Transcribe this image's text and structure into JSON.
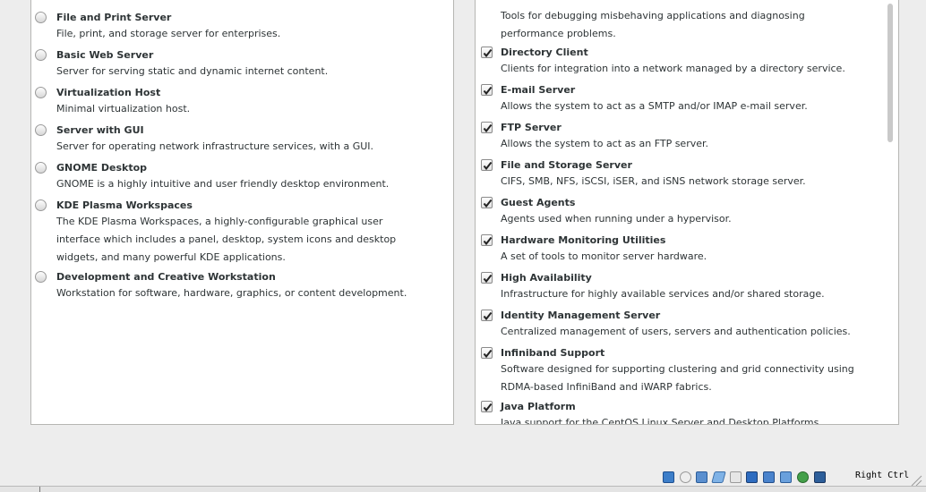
{
  "environment_groups": [
    {
      "title": "",
      "desc": "File, print, and storage server for enterprises.",
      "title_label": "File and Print Server"
    },
    {
      "title_label": "Basic Web Server",
      "desc": "Server for serving static and dynamic internet content."
    },
    {
      "title_label": "Virtualization Host",
      "desc": "Minimal virtualization host."
    },
    {
      "title_label": "Server with GUI",
      "desc": "Server for operating network infrastructure services, with a GUI."
    },
    {
      "title_label": "GNOME Desktop",
      "desc": "GNOME is a highly intuitive and user friendly desktop environment."
    },
    {
      "title_label": "KDE Plasma Workspaces",
      "desc_lines": [
        "The KDE Plasma Workspaces, a highly-configurable graphical user",
        "interface which includes a panel, desktop, system icons and desktop",
        "widgets, and many powerful KDE applications."
      ]
    },
    {
      "title_label": "Development and Creative Workstation",
      "desc": "Workstation for software, hardware, graphics, or content development."
    }
  ],
  "addons": [
    {
      "desc_lines": [
        "Tools for debugging misbehaving applications and diagnosing",
        "performance problems."
      ]
    },
    {
      "title_label": "Directory Client",
      "desc": "Clients for integration into a network managed by a directory service.",
      "checked": true
    },
    {
      "title_label": "E-mail Server",
      "desc": "Allows the system to act as a SMTP and/or IMAP e-mail server.",
      "checked": true
    },
    {
      "title_label": "FTP Server",
      "desc": "Allows the system to act as an FTP server.",
      "checked": true
    },
    {
      "title_label": "File and Storage Server",
      "desc": "CIFS, SMB, NFS, iSCSI, iSER, and iSNS network storage server.",
      "checked": true
    },
    {
      "title_label": "Guest Agents",
      "desc": "Agents used when running under a hypervisor.",
      "checked": true
    },
    {
      "title_label": "Hardware Monitoring Utilities",
      "desc": "A set of tools to monitor server hardware.",
      "checked": true
    },
    {
      "title_label": "High Availability",
      "desc": "Infrastructure for highly available services and/or shared storage.",
      "checked": true
    },
    {
      "title_label": "Identity Management Server",
      "desc": "Centralized management of users, servers and authentication policies.",
      "checked": true
    },
    {
      "title_label": "Infiniband Support",
      "desc_lines": [
        "Software designed for supporting clustering and grid connectivity using",
        "RDMA-based InfiniBand and iWARP fabrics."
      ],
      "checked": true
    },
    {
      "title_label": "Java Platform",
      "desc": "Java support for the CentOS Linux Server and Desktop Platforms.",
      "checked": true
    }
  ],
  "statusbar": {
    "host_key": "Right Ctrl"
  },
  "colors": {
    "panel_bg": "#ffffff",
    "window_bg": "#ededed",
    "text": "#2e3436"
  }
}
